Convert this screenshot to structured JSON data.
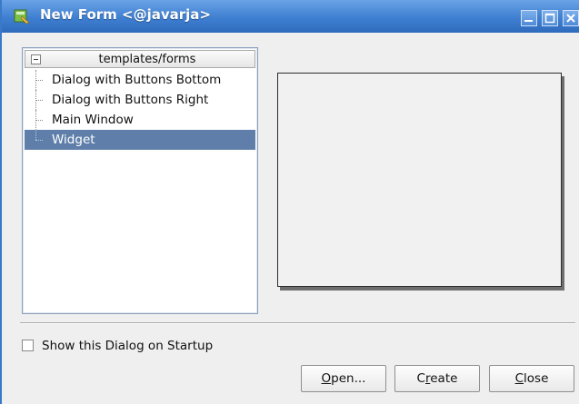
{
  "window": {
    "title": "New Form <@javarja>",
    "icon": "designer-icon"
  },
  "window_controls": [
    "minimize-icon",
    "maximize-icon",
    "close-icon"
  ],
  "tree": {
    "header": "templates/forms",
    "items": [
      {
        "label": "Dialog with Buttons Bottom",
        "selected": false
      },
      {
        "label": "Dialog with Buttons Right",
        "selected": false
      },
      {
        "label": "Main Window",
        "selected": false
      },
      {
        "label": "Widget",
        "selected": true
      }
    ]
  },
  "options": {
    "show_on_startup_label": "Show this Dialog on Startup",
    "show_on_startup_checked": false
  },
  "buttons": {
    "open": {
      "mnemonic": "O",
      "rest": "pen..."
    },
    "create": {
      "pre": "C",
      "mnemonic": "r",
      "rest": "eate"
    },
    "close": {
      "mnemonic": "C",
      "rest": "lose"
    }
  },
  "colors": {
    "titlebar": "#3f7fd1",
    "selection": "#5f7faa",
    "dialog_bg": "#efefef"
  }
}
